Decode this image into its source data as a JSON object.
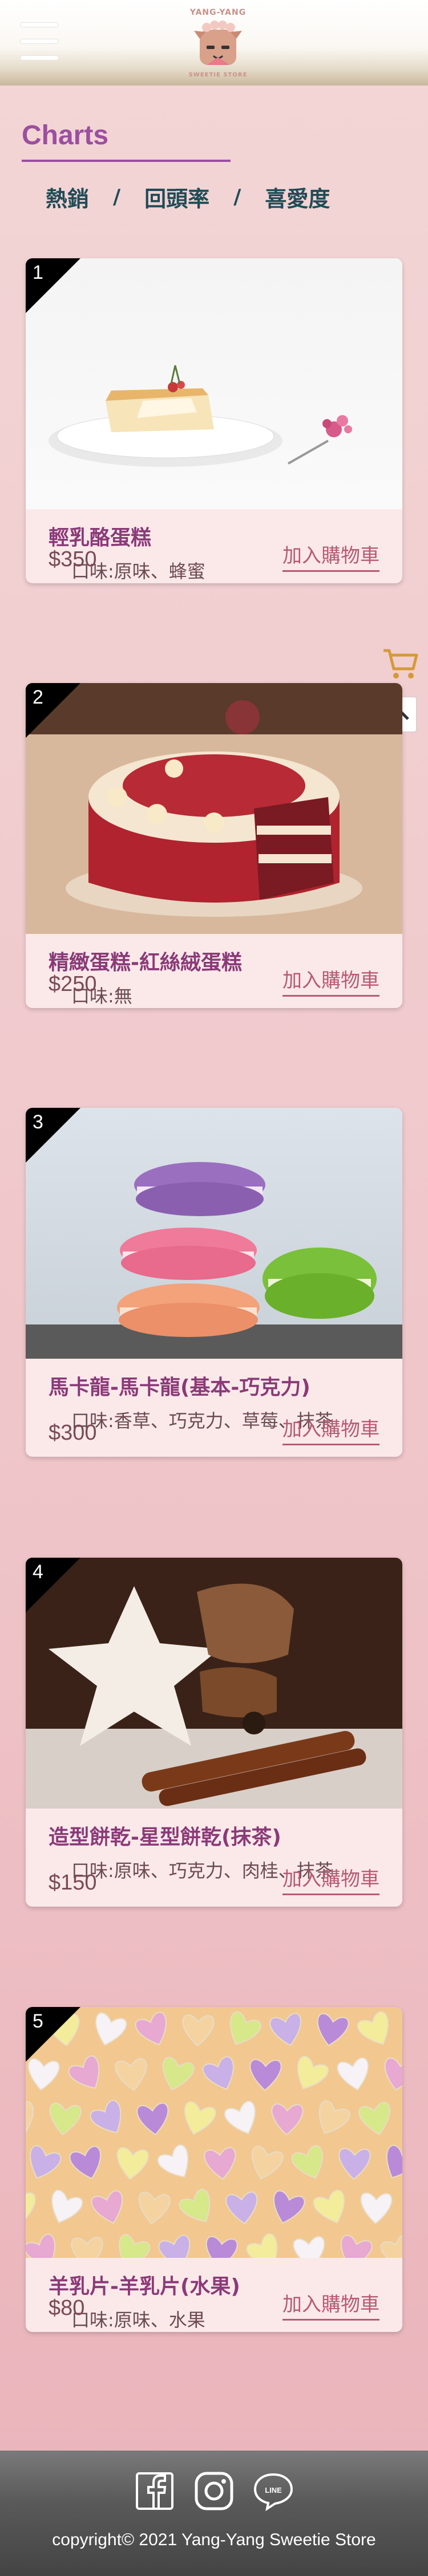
{
  "header": {
    "logo_top": "YANG-YANG",
    "logo_bottom": "SWEETIE STORE"
  },
  "page": {
    "title": "Charts",
    "filters": [
      "熱銷",
      "回頭率",
      "喜愛度"
    ],
    "separator": "/"
  },
  "products": [
    {
      "rank": "1",
      "name": "輕乳酪蛋糕",
      "flavor": "口味:原味、蜂蜜",
      "price": "$350",
      "cta": "加入購物車"
    },
    {
      "rank": "2",
      "name": "精緻蛋糕-紅絲絨蛋糕",
      "flavor": "口味:無",
      "price": "$250",
      "cta": "加入購物車"
    },
    {
      "rank": "3",
      "name": "馬卡龍-馬卡龍(基本-巧克力)",
      "flavor": "口味:香草、巧克力、草莓、抹茶",
      "price": "$300",
      "cta": "加入購物車"
    },
    {
      "rank": "4",
      "name": "造型餅乾-星型餅乾(抹茶)",
      "flavor": "口味:原味、巧克力、肉桂、抹茶",
      "price": "$150",
      "cta": "加入購物車"
    },
    {
      "rank": "5",
      "name": "羊乳片-羊乳片(水果)",
      "flavor": "口味:原味、水果",
      "price": "$80",
      "cta": "加入購物車"
    }
  ],
  "footer": {
    "copyright": "copyright© 2021 Yang-Yang Sweetie Store",
    "social_icons": [
      "facebook-icon",
      "instagram-icon",
      "line-icon"
    ]
  },
  "colors": {
    "accent": "#9b4fa0",
    "filter_text": "#1f4b56",
    "cta": "#b65a73",
    "card_bg": "#fbe9ea"
  }
}
